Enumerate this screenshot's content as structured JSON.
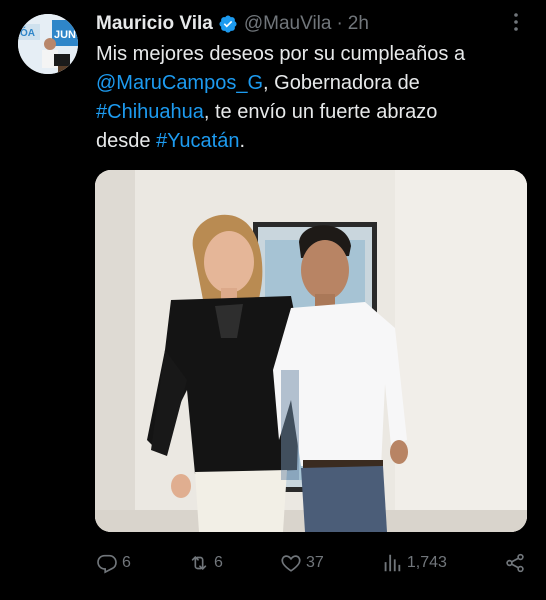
{
  "tweet": {
    "author_name": "Mauricio Vila",
    "handle": "@MauVila",
    "separator": "·",
    "time": "2h",
    "text": {
      "line1": "Mis mejores deseos por su cumpleaños a",
      "mention": "@MaruCampos_G",
      "after_mention": ", Gobernadora de",
      "hashtag1": "#Chihuahua",
      "after_hashtag1": ", te envío un fuerte abrazo",
      "before_hashtag2": "desde ",
      "hashtag2": "#Yucatán",
      "end": "."
    }
  },
  "avatar_text": {
    "left": "ÓA",
    "right": "JUN"
  },
  "actions": {
    "replies": "6",
    "retweets": "6",
    "likes": "37",
    "views": "1,743"
  },
  "icons": {
    "verified": "verified-badge-icon",
    "more": "more-options-icon",
    "reply": "reply-icon",
    "retweet": "retweet-icon",
    "like": "heart-icon",
    "views": "views-icon",
    "share": "share-icon"
  },
  "colors": {
    "background": "#000000",
    "text": "#e7e9ea",
    "muted": "#71767b",
    "link": "#1d9bf0"
  }
}
